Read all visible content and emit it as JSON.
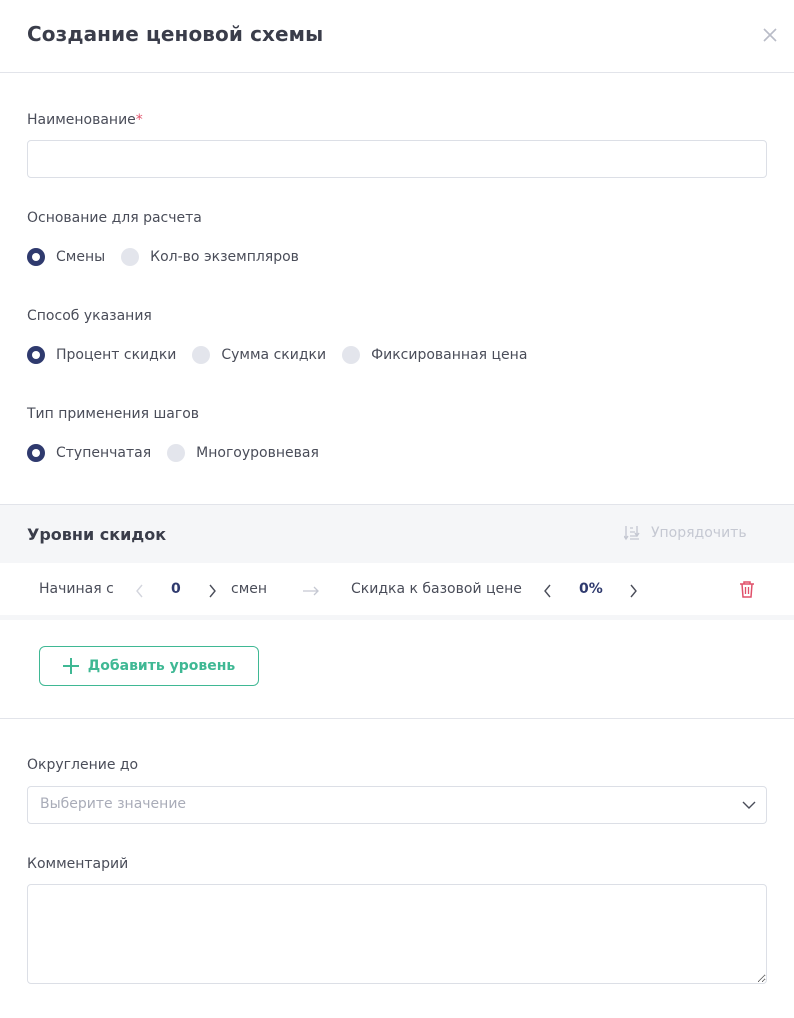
{
  "header": {
    "title": "Создание ценовой схемы"
  },
  "name_field": {
    "label": "Наименование",
    "required_mark": "*",
    "value": "",
    "placeholder": ""
  },
  "basis": {
    "label": "Основание для расчета",
    "options": [
      "Смены",
      "Кол-во экземпляров"
    ],
    "selected": "Смены"
  },
  "method": {
    "label": "Способ указания",
    "options": [
      "Процент скидки",
      "Сумма скидки",
      "Фиксированная цена"
    ],
    "selected": "Процент скидки"
  },
  "step_type": {
    "label": "Тип применения шагов",
    "options": [
      "Ступенчатая",
      "Многоуровневая"
    ],
    "selected": "Ступенчатая"
  },
  "levels": {
    "title": "Уровни скидок",
    "sort_label": "Упорядочить",
    "rows": [
      {
        "start_label": "Начиная с",
        "start_value": "0",
        "unit": "смен",
        "discount_label": "Скидка к базовой цене",
        "discount_value": "0%"
      }
    ],
    "add_label": "Добавить уровень"
  },
  "rounding": {
    "label": "Округление до",
    "placeholder": "Выберите значение"
  },
  "comment": {
    "label": "Комментарий",
    "value": ""
  },
  "colors": {
    "accent_dark": "#2f3a6e",
    "accent_green": "#3fb894",
    "danger": "#e0506a",
    "muted": "#c5c8d2"
  }
}
